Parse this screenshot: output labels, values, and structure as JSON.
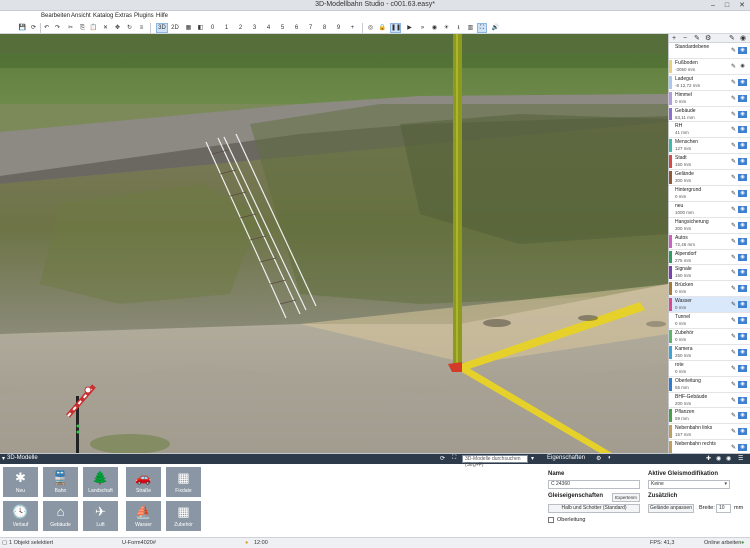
{
  "window": {
    "title": "3D-Modellbahn Studio - c001.63.easy*"
  },
  "menu": {
    "back": "‹",
    "items": [
      "Bearbeiten",
      "Ansicht",
      "Katalog",
      "Extras",
      "Plugins",
      "Hilfe"
    ]
  },
  "toolbar": {
    "view_modes": [
      "3D",
      "2D"
    ],
    "numbers": [
      "0",
      "1",
      "2",
      "3",
      "4",
      "5",
      "6",
      "7",
      "8",
      "9"
    ]
  },
  "layers": {
    "items": [
      {
        "name": "Standardebene",
        "value": "",
        "color": "#ffffff",
        "selected": false,
        "visible": true
      },
      {
        "name": "Fußboden",
        "value": "-3050 mm",
        "color": "#e9d37a",
        "selected": false,
        "visible": false
      },
      {
        "name": "Ladegut",
        "value": "-8 12,72 mm",
        "color": "#a9c9e8",
        "selected": false,
        "visible": true
      },
      {
        "name": "Himmel",
        "value": "0 mm",
        "color": "#b49be0",
        "selected": false,
        "visible": true
      },
      {
        "name": "Gebäude",
        "value": "63,11 mm",
        "color": "#8e6fd0",
        "selected": false,
        "visible": true
      },
      {
        "name": "RH",
        "value": "41 mm",
        "color": "#ffffff",
        "selected": false,
        "visible": true
      },
      {
        "name": "Menschen",
        "value": "127 mm",
        "color": "#42b8a8",
        "selected": false,
        "visible": true
      },
      {
        "name": "Stadt",
        "value": "150 mm",
        "color": "#d24b4b",
        "selected": false,
        "visible": true
      },
      {
        "name": "Gelände",
        "value": "300 mm",
        "color": "#8e5a3a",
        "selected": false,
        "visible": true
      },
      {
        "name": "Hintergrund",
        "value": "0 mm",
        "color": "#ffffff",
        "selected": false,
        "visible": true
      },
      {
        "name": "neu",
        "value": "1000 mm",
        "color": "#ffffff",
        "selected": false,
        "visible": true
      },
      {
        "name": "Hangsicherung",
        "value": "300 mm",
        "color": "#ffffff",
        "selected": false,
        "visible": true
      },
      {
        "name": "Autos",
        "value": "72,46 mm",
        "color": "#d060c0",
        "selected": false,
        "visible": true
      },
      {
        "name": "Alpendorf",
        "value": "275 mm",
        "color": "#2d9e60",
        "selected": false,
        "visible": true
      },
      {
        "name": "Signale",
        "value": "150 mm",
        "color": "#7b3fb0",
        "selected": false,
        "visible": true
      },
      {
        "name": "Brücken",
        "value": "0 mm",
        "color": "#a77a30",
        "selected": false,
        "visible": true
      },
      {
        "name": "Wasser",
        "value": "0 mm",
        "color": "#d84b8e",
        "selected": true,
        "visible": true
      },
      {
        "name": "Tunnel",
        "value": "0 mm",
        "color": "#ffffff",
        "selected": false,
        "visible": true
      },
      {
        "name": "Zubehör",
        "value": "0 mm",
        "color": "#5fb56a",
        "selected": false,
        "visible": true
      },
      {
        "name": "Kamera",
        "value": "250 mm",
        "color": "#3ea4d6",
        "selected": false,
        "visible": true
      },
      {
        "name": "rote",
        "value": "0 mm",
        "color": "#ffffff",
        "selected": false,
        "visible": true
      },
      {
        "name": "Oberleitung",
        "value": "55 mm",
        "color": "#2f7dd0",
        "selected": false,
        "visible": true
      },
      {
        "name": "BHF-Gebäude",
        "value": "200 mm",
        "color": "#ffffff",
        "selected": false,
        "visible": true
      },
      {
        "name": "Pflanzen",
        "value": "59 mm",
        "color": "#4aa04a",
        "selected": false,
        "visible": true
      },
      {
        "name": "Nebenbahn links",
        "value": "157 mm",
        "color": "#c0a060",
        "selected": false,
        "visible": true
      },
      {
        "name": "Nebenbahn rechts",
        "value": "",
        "color": "#c0a060",
        "selected": false,
        "visible": true
      }
    ]
  },
  "models_panel": {
    "title": "3D-Modelle",
    "search_placeholder": "3D-Modelle durchsuchen (Strg+F)",
    "tiles": [
      {
        "label": "Neu",
        "glyph": "✱"
      },
      {
        "label": "Bahn",
        "glyph": "🚆"
      },
      {
        "label": "Landschaft",
        "glyph": "🌲"
      },
      {
        "label": "Straße",
        "glyph": "🚗"
      },
      {
        "label": "Fixdate",
        "glyph": "▦"
      },
      {
        "label": "Verlauf",
        "glyph": "🕓"
      },
      {
        "label": "Gebäude",
        "glyph": "⌂"
      },
      {
        "label": "Luft",
        "glyph": "✈"
      },
      {
        "label": "Wasser",
        "glyph": "⛵"
      },
      {
        "label": "Zubehör",
        "glyph": "▦"
      }
    ]
  },
  "properties": {
    "title": "Eigenschaften",
    "name_label": "Name",
    "name_value": "C 24360",
    "track_props_label": "Gleiseigenschaften",
    "track_props_badge": "Expertenm",
    "ballast_button": "Halb und Schotter (Standard)",
    "overhead_label": "Oberleitung",
    "active_mod_label": "Aktive Gleismodifikation",
    "active_mod_value": "Keine",
    "extra_label": "Zusätzlich",
    "adjust_terrain_button": "Gelände anpassen",
    "width_label": "Breite:",
    "width_value": "10",
    "width_unit": "mm"
  },
  "statusbar": {
    "selection": "1 Objekt selektiert",
    "position": "U-Form4020#",
    "time": "12:00",
    "fps": "FPS: 41,3",
    "mode": "Online arbeiten"
  }
}
